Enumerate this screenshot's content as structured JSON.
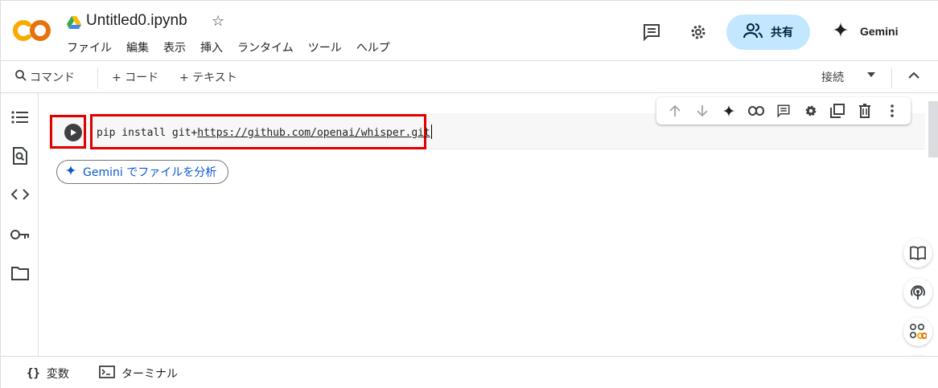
{
  "header": {
    "notebook_title": "Untitled0.ipynb",
    "menu": [
      "ファイル",
      "編集",
      "表示",
      "挿入",
      "ランタイム",
      "ツール",
      "ヘルプ"
    ],
    "share_label": "共有",
    "gemini_label": "Gemini"
  },
  "toolbar": {
    "command_label": "コマンド",
    "add_code_label": "+ コード",
    "add_text_label": "+ テキスト",
    "connect_label": "接続"
  },
  "cell": {
    "code_prefix": "pip install git+",
    "code_url": "https://github.com/openai/whisper.git"
  },
  "gemini_pill": {
    "label": "Gemini でファイルを分析"
  },
  "statusbar": {
    "variables_label": "変数",
    "terminal_label": "ターミナル"
  },
  "colors": {
    "accent_red_box": "#e00000",
    "share_bg": "#c2e7ff",
    "gemini_blue": "#0b57d0",
    "logo_orange": "#f9ab00",
    "logo_dark_orange": "#e8710a"
  }
}
